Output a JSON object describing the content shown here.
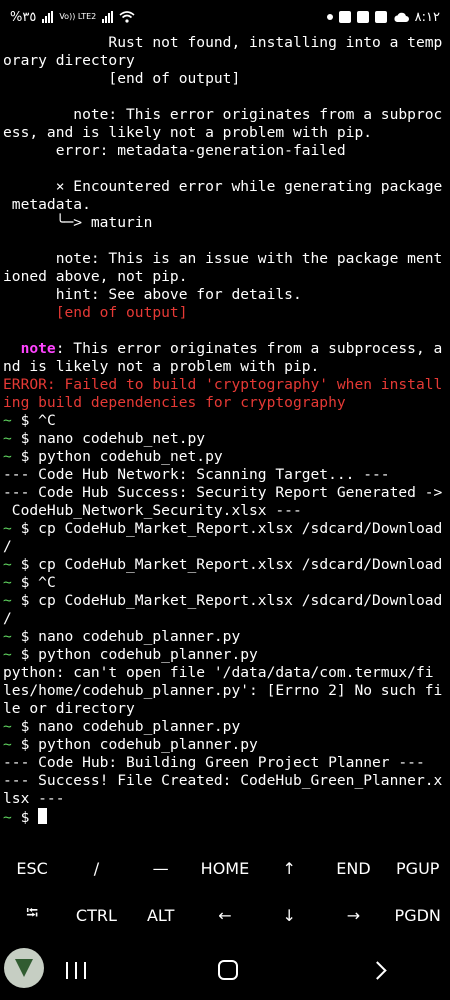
{
  "status_bar": {
    "left_text": "%٣٥",
    "volte_label": "Vo)) LTE2",
    "time": "٨:١٢"
  },
  "terminal": {
    "colors": {
      "error": "#e53935",
      "note": "#ff44ff",
      "prompt": "#5fd35f",
      "text": "#ffffff"
    },
    "lines": [
      [
        {
          "t": "            Rust not found, installing into a temp"
        }
      ],
      [
        {
          "t": "orary directory"
        }
      ],
      [
        {
          "t": "            [end of output]"
        }
      ],
      [
        {
          "t": ""
        }
      ],
      [
        {
          "t": "        note: This error originates from a subproc"
        }
      ],
      [
        {
          "t": "ess, and is likely not a problem with pip."
        }
      ],
      [
        {
          "t": "      error: metadata-generation-failed"
        }
      ],
      [
        {
          "t": ""
        }
      ],
      [
        {
          "t": "      × Encountered error while generating package"
        }
      ],
      [
        {
          "t": " metadata."
        }
      ],
      [
        {
          "t": "      ╰─> maturin"
        }
      ],
      [
        {
          "t": ""
        }
      ],
      [
        {
          "t": "      note: This is an issue with the package ment"
        }
      ],
      [
        {
          "t": "ioned above, not pip."
        }
      ],
      [
        {
          "t": "      hint: See above for details."
        }
      ],
      [
        {
          "t": "      [end of output]",
          "c": "red"
        }
      ],
      [
        {
          "t": ""
        }
      ],
      [
        {
          "t": "  "
        },
        {
          "t": "note",
          "c": "mag"
        },
        {
          "t": ": This error originates from a subprocess, a"
        }
      ],
      [
        {
          "t": "nd is likely not a problem with pip."
        }
      ],
      [
        {
          "t": "ERROR: Failed to build 'cryptography' when install",
          "c": "red"
        }
      ],
      [
        {
          "t": "ing build dependencies for cryptography",
          "c": "red"
        }
      ],
      [
        {
          "t": "~",
          "c": "grn"
        },
        {
          "t": " $ ^C"
        }
      ],
      [
        {
          "t": "~",
          "c": "grn"
        },
        {
          "t": " $ nano codehub_net.py"
        }
      ],
      [
        {
          "t": "~",
          "c": "grn"
        },
        {
          "t": " $ python codehub_net.py"
        }
      ],
      [
        {
          "t": "--- Code Hub Network: Scanning Target... ---"
        }
      ],
      [
        {
          "t": "--- Code Hub Success: Security Report Generated ->"
        }
      ],
      [
        {
          "t": " CodeHub_Network_Security.xlsx ---"
        }
      ],
      [
        {
          "t": "~",
          "c": "grn"
        },
        {
          "t": " $ cp CodeHub_Market_Report.xlsx /sdcard/Download"
        }
      ],
      [
        {
          "t": "/"
        }
      ],
      [
        {
          "t": "~",
          "c": "grn"
        },
        {
          "t": " $ cp CodeHub_Market_Report.xlsx /sdcard/Download"
        }
      ],
      [
        {
          "t": "~",
          "c": "grn"
        },
        {
          "t": " $ ^C"
        }
      ],
      [
        {
          "t": "~",
          "c": "grn"
        },
        {
          "t": " $ cp CodeHub_Market_Report.xlsx /sdcard/Download"
        }
      ],
      [
        {
          "t": "/"
        }
      ],
      [
        {
          "t": "~",
          "c": "grn"
        },
        {
          "t": " $ nano codehub_planner.py"
        }
      ],
      [
        {
          "t": "~",
          "c": "grn"
        },
        {
          "t": " $ python codehub_planner.py"
        }
      ],
      [
        {
          "t": "python: can't open file '/data/data/com.termux/fi"
        }
      ],
      [
        {
          "t": "les/home/codehub_planner.py': [Errno 2] No such fi"
        }
      ],
      [
        {
          "t": "le or directory"
        }
      ],
      [
        {
          "t": "~",
          "c": "grn"
        },
        {
          "t": " $ nano codehub_planner.py"
        }
      ],
      [
        {
          "t": "~",
          "c": "grn"
        },
        {
          "t": " $ python codehub_planner.py"
        }
      ],
      [
        {
          "t": "--- Code Hub: Building Green Project Planner ---"
        }
      ],
      [
        {
          "t": "--- Success! File Created: CodeHub_Green_Planner.x"
        }
      ],
      [
        {
          "t": "lsx ---"
        }
      ],
      [
        {
          "t": "~",
          "c": "grn"
        },
        {
          "t": " $ "
        },
        {
          "cursor": true
        }
      ]
    ]
  },
  "extra_keys": {
    "row1": [
      "ESC",
      "/",
      "—",
      "HOME",
      "↑",
      "END",
      "PGUP"
    ],
    "row2": [
      "⭾",
      "CTRL",
      "ALT",
      "←",
      "↓",
      "→",
      "PGDN"
    ]
  }
}
